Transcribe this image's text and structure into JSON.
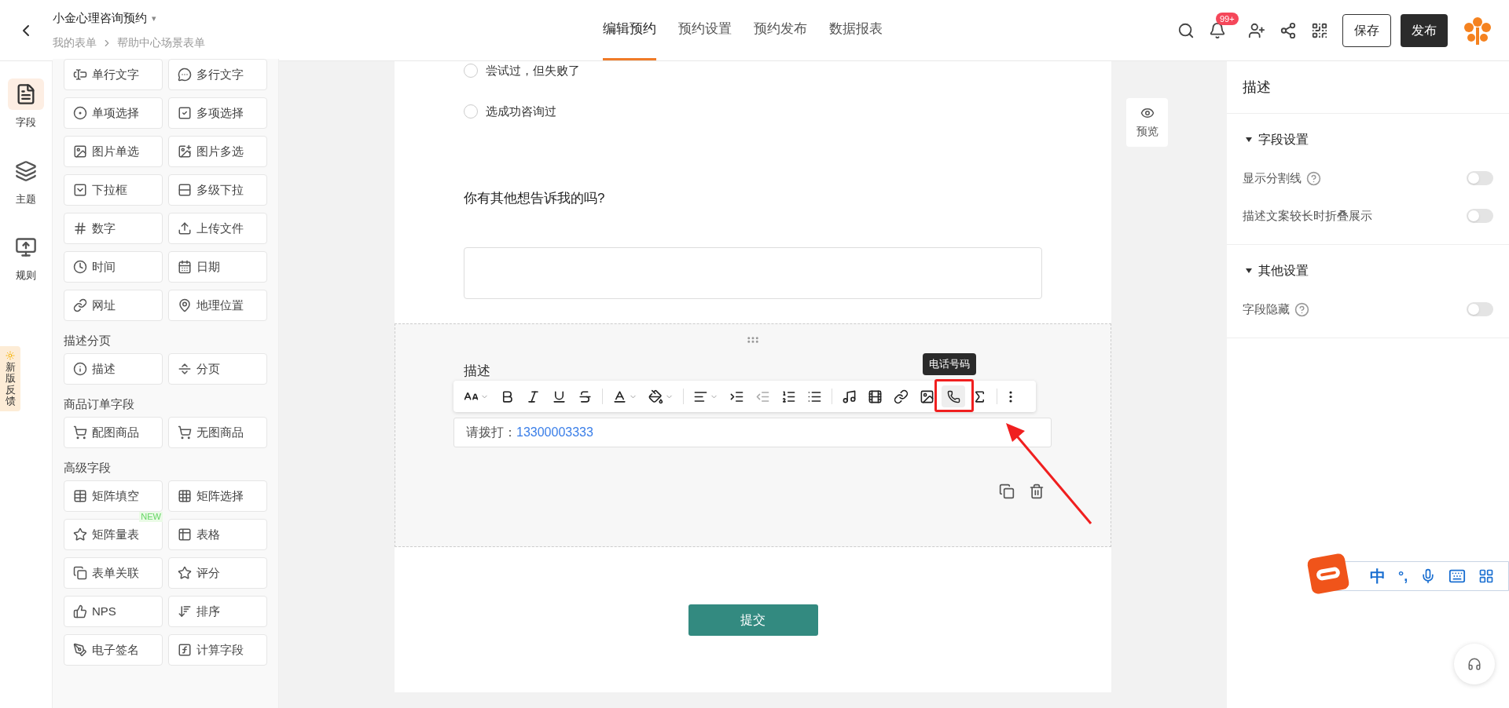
{
  "header": {
    "title": "小金心理咨询预约",
    "caret": "▾",
    "breadcrumb": [
      "我的表单",
      "帮助中心场景表单"
    ],
    "tabs": [
      {
        "label": "编辑预约",
        "selected": true
      },
      {
        "label": "预约设置",
        "selected": false
      },
      {
        "label": "预约发布",
        "selected": false
      },
      {
        "label": "数据报表",
        "selected": false
      }
    ],
    "notification_badge": "99+",
    "save": "保存",
    "publish": "发布"
  },
  "rail": {
    "items": [
      {
        "label": "字段",
        "selected": true
      },
      {
        "label": "主题",
        "selected": false
      },
      {
        "label": "规则",
        "selected": false
      }
    ],
    "feedback": "新版反馈"
  },
  "field_panel": {
    "groups": [
      {
        "items": [
          {
            "label": "单行文字"
          },
          {
            "label": "多行文字"
          },
          {
            "label": "单项选择"
          },
          {
            "label": "多项选择"
          },
          {
            "label": "图片单选"
          },
          {
            "label": "图片多选"
          },
          {
            "label": "下拉框"
          },
          {
            "label": "多级下拉"
          },
          {
            "label": "数字"
          },
          {
            "label": "上传文件"
          },
          {
            "label": "时间"
          },
          {
            "label": "日期"
          },
          {
            "label": "网址"
          },
          {
            "label": "地理位置"
          }
        ]
      },
      {
        "title": "描述分页",
        "items": [
          {
            "label": "描述"
          },
          {
            "label": "分页"
          }
        ]
      },
      {
        "title": "商品订单字段",
        "items": [
          {
            "label": "配图商品"
          },
          {
            "label": "无图商品"
          }
        ]
      },
      {
        "title": "高级字段",
        "items": [
          {
            "label": "矩阵填空"
          },
          {
            "label": "矩阵选择"
          },
          {
            "label": "矩阵量表",
            "badge": "NEW"
          },
          {
            "label": "表格"
          },
          {
            "label": "表单关联"
          },
          {
            "label": "评分"
          },
          {
            "label": "NPS"
          },
          {
            "label": "排序"
          },
          {
            "label": "电子签名"
          },
          {
            "label": "计算字段"
          }
        ]
      }
    ]
  },
  "form": {
    "options": [
      {
        "label": "尝试过，但失败了",
        "selected": false
      },
      {
        "label": "选成功咨询过",
        "selected": false
      }
    ],
    "question": "你有其他想告诉我的吗?",
    "description_block": {
      "label": "描述",
      "tooltip": "电话号码",
      "content_prefix": "请拨打：",
      "phone": "13300003333"
    },
    "submit": "提交"
  },
  "preview": "预览",
  "settings": {
    "title": "描述",
    "sections": [
      {
        "title": "字段设置",
        "expanded": true,
        "items": [
          {
            "label": "显示分割线",
            "help": true,
            "on": false
          },
          {
            "label": "描述文案较长时折叠展示",
            "help": false,
            "on": false
          }
        ]
      },
      {
        "title": "其他设置",
        "expanded": true,
        "items": [
          {
            "label": "字段隐藏",
            "help": true,
            "on": false
          }
        ]
      }
    ]
  },
  "ime": {
    "mode": "中",
    "punct": "°,"
  }
}
